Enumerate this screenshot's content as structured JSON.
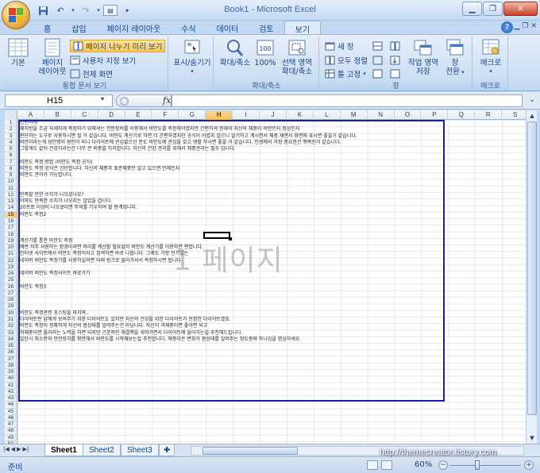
{
  "window": {
    "title": "Book1 - Microsoft Excel"
  },
  "tabs": [
    "홈",
    "삽입",
    "페이지 레이아웃",
    "수식",
    "데이터",
    "검토",
    "보기"
  ],
  "active_tab": "보기",
  "ribbon": {
    "workbook_views": {
      "label": "통합 문서 보기",
      "normal": "기본",
      "page_layout_1": "페이지",
      "page_layout_2": "레이아웃",
      "page_break_preview": "페이지 나누기 미리 보기",
      "custom_views": "사용자 지정 보기",
      "full_screen": "전체 화면"
    },
    "show_hide": {
      "label": "표시/숨기기"
    },
    "zoom": {
      "label": "확대/축소",
      "zoom_btn": "확대/축소",
      "hundred": "100%",
      "sel_1": "선택 영역",
      "sel_2": "확대/축소"
    },
    "window": {
      "label": "창",
      "new_window": "새 창",
      "arrange_all": "모두 정렬",
      "freeze_panes": "틀 고정",
      "save_ws_1": "작업 영역",
      "save_ws_2": "저장",
      "switch_1": "창",
      "switch_2": "전환"
    },
    "macros": {
      "label": "매크로",
      "btn": "매크로"
    }
  },
  "formula_bar": {
    "name_box": "H15",
    "fx": "fx",
    "value": ""
  },
  "columns": [
    "A",
    "B",
    "C",
    "D",
    "E",
    "F",
    "G",
    "H",
    "I",
    "J",
    "K",
    "L",
    "M",
    "N",
    "O",
    "P",
    "Q",
    "R",
    "S"
  ],
  "active_column": "H",
  "active_row": 15,
  "rows": [
    {
      "n": "1",
      "t": "간편하게"
    },
    {
      "n": "2",
      "t": "체지방을 조금 자세하게 측정하기 위해서는 전문장비를 이용해서 비만도를 측정해야겠지만 간편하게 현재의 자신의 체중이 비만인지 정상인지"
    },
    {
      "n": "3",
      "t": "판단하는 도구로 사용하시면 될 거 같습니다. 비만도 계산기로 하면 더 간편하겠지만 공식이 어렵지 않으니 알기하고 계시면서 체중 재면서 화면에 표시면 좋을거 같습니다."
    },
    {
      "n": "4",
      "t": "비만이라는게 성인병의 원인이 되니 다이어트에 관심없으신 분도 비만도에 관심을 갖고 생활 하시면 좋을 거 같습니다. 인생에서 가장 중요한건 행복인거 같습니다."
    },
    {
      "n": "5",
      "t": "그렇게도 값어 건강이라는건 너무 큰 비중을 차지합니다. 자신의 건강 관리를 위해서 체중관리는 필수 입니다."
    },
    {
      "n": "6",
      "t": ""
    },
    {
      "n": "7",
      "t": "비만도 측정 방법 (비만도 측정 공식)"
    },
    {
      "n": "8",
      "t": "비만도 측정 공식은 간단합니다. 자신의 체중과 표준체중만 알고 있으면 언제든지"
    },
    {
      "n": "9",
      "t": "비만도 관리가 가능합니다."
    },
    {
      "n": "10",
      "t": ""
    },
    {
      "n": "11",
      "t": ""
    },
    {
      "n": "12",
      "t": "만족할 만한 수치가 나오셨나요?"
    },
    {
      "n": "13",
      "t": "아마도 만족한 수치가 나오지는 않았을 겁니다."
    },
    {
      "n": "14",
      "t": "20프로 이상이 나오셨다면 주의를 기우하여 할 판계입니다."
    },
    {
      "n": "15",
      "t": "비만도 측정2"
    },
    {
      "n": "16",
      "t": ""
    },
    {
      "n": "17",
      "t": ""
    },
    {
      "n": "18",
      "t": ""
    },
    {
      "n": "19",
      "t": "계산기를 통한 비만도 측정"
    },
    {
      "n": "20",
      "t": "매번 자주 사용하는 환경이라면 머리를 계산할 필요없이 비만도 계산기를 이용하면 편합니다."
    },
    {
      "n": "21",
      "t": "인터넷 사이트에서 비만도 측정이라고 검색하면 바로 나옵니다. 그래도 가장 인기있는"
    },
    {
      "n": "22",
      "t": "네이버 비만도 측정기를 사용하실려면 아래 링크로 들어가셔서 측정하시면 됩니다."
    },
    {
      "n": "23",
      "t": ""
    },
    {
      "n": "24",
      "t": "네이버 비만도 측정사이트 바로가기"
    },
    {
      "n": "25",
      "t": ""
    },
    {
      "n": "26",
      "t": "비만도 측정3"
    },
    {
      "n": "27",
      "t": ""
    },
    {
      "n": "28",
      "t": ""
    },
    {
      "n": "29",
      "t": ""
    },
    {
      "n": "30",
      "t": "비만도 측정관련 포스팅을 마치며.."
    },
    {
      "n": "31",
      "t": "다이어트란 남에게 보여주기 위한 다이어트도 있지만 자신의 건강을 위한 다이어트가 진정한 다이어트겠죠."
    },
    {
      "n": "32",
      "t": "비만도 측정이 정확하게 자신의 몸상태를 알려주는건 아닙니다. 자신이 과체중이면 좋아면 되고"
    },
    {
      "n": "33",
      "t": "저체중이면 올리려는 노력을 하면 되지만 근본적인 해결책을 세워가면서 다이어트에 들어가는걸 추천해드립니다."
    },
    {
      "n": "34",
      "t": "일단시 최소한의 안전장치를 확한해서 비만도를 시작해보는걸 추천합니다. 체중이든 변화가 몸상태를 알려주는 정도중에 하나임을 명심하세요."
    },
    {
      "n": "35",
      "t": ""
    },
    {
      "n": "36",
      "t": ""
    },
    {
      "n": "37",
      "t": ""
    },
    {
      "n": "38",
      "t": ""
    },
    {
      "n": "39",
      "t": ""
    },
    {
      "n": "40",
      "t": ""
    },
    {
      "n": "41",
      "t": ""
    },
    {
      "n": "42",
      "t": ""
    },
    {
      "n": "43",
      "t": ""
    },
    {
      "n": "44",
      "t": ""
    },
    {
      "n": "45",
      "t": ""
    },
    {
      "n": "46",
      "t": ""
    },
    {
      "n": "47",
      "t": ""
    },
    {
      "n": "48",
      "t": ""
    },
    {
      "n": "49",
      "t": ""
    },
    {
      "n": "50",
      "t": ""
    }
  ],
  "page_label": "1 페이지",
  "sheets": [
    "Sheet1",
    "Sheet2",
    "Sheet3"
  ],
  "active_sheet": "Sheet1",
  "status": {
    "ready": "준비",
    "zoom": "60%",
    "zoom_minus": "−",
    "zoom_plus": "+"
  },
  "overlay_watermark": "http://themecreator.tistory.com",
  "colors": {
    "accent": "#15428b",
    "page_border": "#1c1ca8",
    "highlight": "#f1c15f"
  }
}
